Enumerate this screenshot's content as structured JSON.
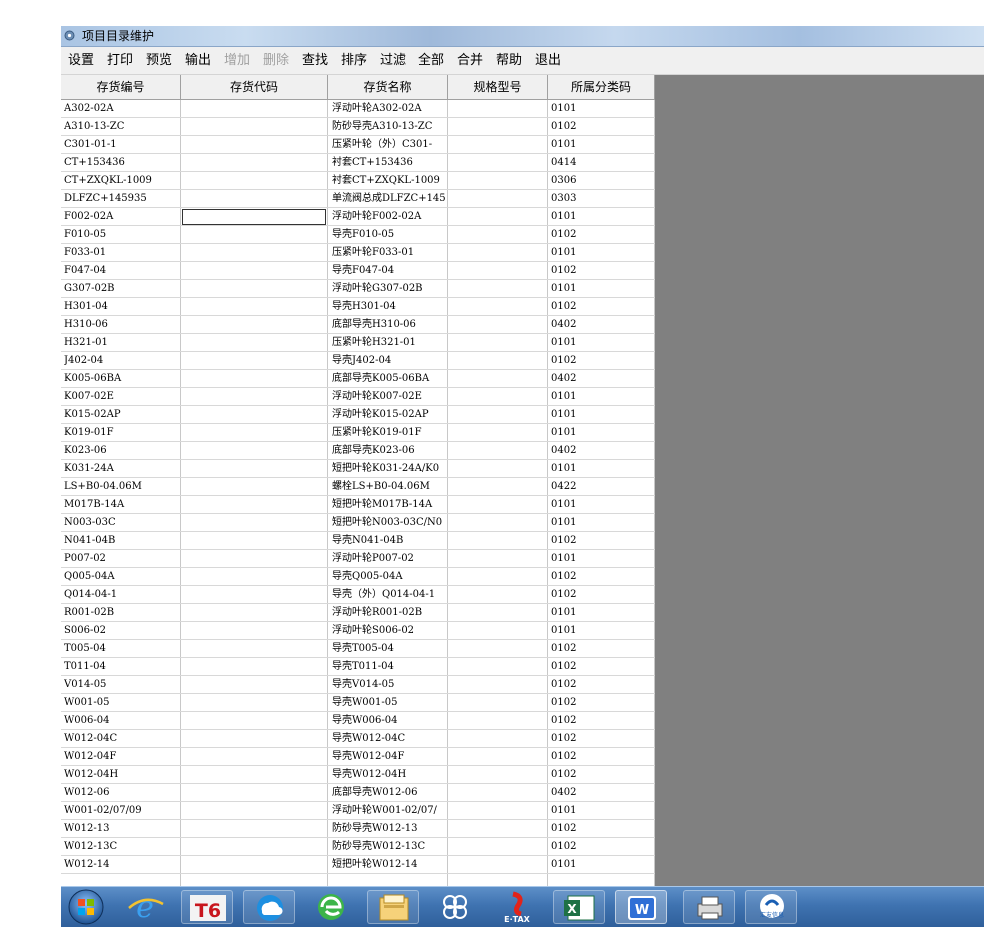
{
  "window": {
    "title": "项目目录维护"
  },
  "menu": [
    {
      "label": "设置",
      "enabled": true
    },
    {
      "label": "打印",
      "enabled": true
    },
    {
      "label": "预览",
      "enabled": true
    },
    {
      "label": "输出",
      "enabled": true
    },
    {
      "label": "增加",
      "enabled": false
    },
    {
      "label": "删除",
      "enabled": false
    },
    {
      "label": "查找",
      "enabled": true
    },
    {
      "label": "排序",
      "enabled": true
    },
    {
      "label": "过滤",
      "enabled": true
    },
    {
      "label": "全部",
      "enabled": true
    },
    {
      "label": "合并",
      "enabled": true
    },
    {
      "label": "帮助",
      "enabled": true
    },
    {
      "label": "退出",
      "enabled": true
    }
  ],
  "columns": [
    "存货编号",
    "存货代码",
    "存货名称",
    "规格型号",
    "所属分类码"
  ],
  "rows": [
    [
      "A302-02A",
      "",
      "浮动叶轮A302-02A",
      "",
      "0101"
    ],
    [
      "A310-13-ZC",
      "",
      "防砂导壳A310-13-ZC",
      "",
      "0102"
    ],
    [
      "C301-01-1",
      "",
      "压紧叶轮（外）C301-",
      "",
      "0101"
    ],
    [
      "CT+153436",
      "",
      "衬套CT+153436",
      "",
      "0414"
    ],
    [
      "CT+ZXQKL-1009",
      "",
      "衬套CT+ZXQKL-1009",
      "",
      "0306"
    ],
    [
      "DLFZC+145935",
      "",
      "单流阀总成DLFZC+145",
      "",
      "0303"
    ],
    [
      "F002-02A",
      "",
      "浮动叶轮F002-02A",
      "",
      "0101"
    ],
    [
      "F010-05",
      "",
      "导壳F010-05",
      "",
      "0102"
    ],
    [
      "F033-01",
      "",
      "压紧叶轮F033-01",
      "",
      "0101"
    ],
    [
      "F047-04",
      "",
      "导壳F047-04",
      "",
      "0102"
    ],
    [
      "G307-02B",
      "",
      "浮动叶轮G307-02B",
      "",
      "0101"
    ],
    [
      "H301-04",
      "",
      "导壳H301-04",
      "",
      "0102"
    ],
    [
      "H310-06",
      "",
      "底部导壳H310-06",
      "",
      "0402"
    ],
    [
      "H321-01",
      "",
      "压紧叶轮H321-01",
      "",
      "0101"
    ],
    [
      "J402-04",
      "",
      "导壳J402-04",
      "",
      "0102"
    ],
    [
      "K005-06BA",
      "",
      "底部导壳K005-06BA",
      "",
      "0402"
    ],
    [
      "K007-02E",
      "",
      "浮动叶轮K007-02E",
      "",
      "0101"
    ],
    [
      "K015-02AP",
      "",
      "浮动叶轮K015-02AP",
      "",
      "0101"
    ],
    [
      "K019-01F",
      "",
      "压紧叶轮K019-01F",
      "",
      "0101"
    ],
    [
      "K023-06",
      "",
      "底部导壳K023-06",
      "",
      "0402"
    ],
    [
      "K031-24A",
      "",
      "短把叶轮K031-24A/K0",
      "",
      "0101"
    ],
    [
      "LS+B0-04.06M",
      "",
      "螺栓LS+B0-04.06M",
      "",
      "0422"
    ],
    [
      "M017B-14A",
      "",
      "短把叶轮M017B-14A",
      "",
      "0101"
    ],
    [
      "N003-03C",
      "",
      "短把叶轮N003-03C/N0",
      "",
      "0101"
    ],
    [
      "N041-04B",
      "",
      "导壳N041-04B",
      "",
      "0102"
    ],
    [
      "P007-02",
      "",
      "浮动叶轮P007-02",
      "",
      "0101"
    ],
    [
      "Q005-04A",
      "",
      "导壳Q005-04A",
      "",
      "0102"
    ],
    [
      "Q014-04-1",
      "",
      "导壳（外）Q014-04-1",
      "",
      "0102"
    ],
    [
      "R001-02B",
      "",
      "浮动叶轮R001-02B",
      "",
      "0101"
    ],
    [
      "S006-02",
      "",
      "浮动叶轮S006-02",
      "",
      "0101"
    ],
    [
      "T005-04",
      "",
      "导壳T005-04",
      "",
      "0102"
    ],
    [
      "T011-04",
      "",
      "导壳T011-04",
      "",
      "0102"
    ],
    [
      "V014-05",
      "",
      "导壳V014-05",
      "",
      "0102"
    ],
    [
      "W001-05",
      "",
      "导壳W001-05",
      "",
      "0102"
    ],
    [
      "W006-04",
      "",
      "导壳W006-04",
      "",
      "0102"
    ],
    [
      "W012-04C",
      "",
      "导壳W012-04C",
      "",
      "0102"
    ],
    [
      "W012-04F",
      "",
      "导壳W012-04F",
      "",
      "0102"
    ],
    [
      "W012-04H",
      "",
      "导壳W012-04H",
      "",
      "0102"
    ],
    [
      "W012-06",
      "",
      "底部导壳W012-06",
      "",
      "0402"
    ],
    [
      "W001-02/07/09",
      "",
      "浮动叶轮W001-02/07/",
      "",
      "0101"
    ],
    [
      "W012-13",
      "",
      "防砂导壳W012-13",
      "",
      "0102"
    ],
    [
      "W012-13C",
      "",
      "防砂导壳W012-13C",
      "",
      "0102"
    ],
    [
      "W012-14",
      "",
      "短把叶轮W012-14",
      "",
      "0101"
    ]
  ],
  "taskbar": {
    "items": [
      {
        "name": "start-button"
      },
      {
        "name": "ie-icon"
      },
      {
        "name": "t6-app-icon",
        "label": "T6"
      },
      {
        "name": "cloud-app-icon"
      },
      {
        "name": "browser-icon"
      },
      {
        "name": "file-explorer-icon"
      },
      {
        "name": "clover-app-icon"
      },
      {
        "name": "etax-icon",
        "label": "E·TAX"
      },
      {
        "name": "excel-icon"
      },
      {
        "name": "wps-icon"
      },
      {
        "name": "printer-icon"
      },
      {
        "name": "huiyou-app-icon",
        "label": "汇友信息"
      }
    ]
  },
  "colors": {
    "window_background": "#808080",
    "taskbar": "#3f73b1",
    "menubar": "#f0f0f0"
  }
}
